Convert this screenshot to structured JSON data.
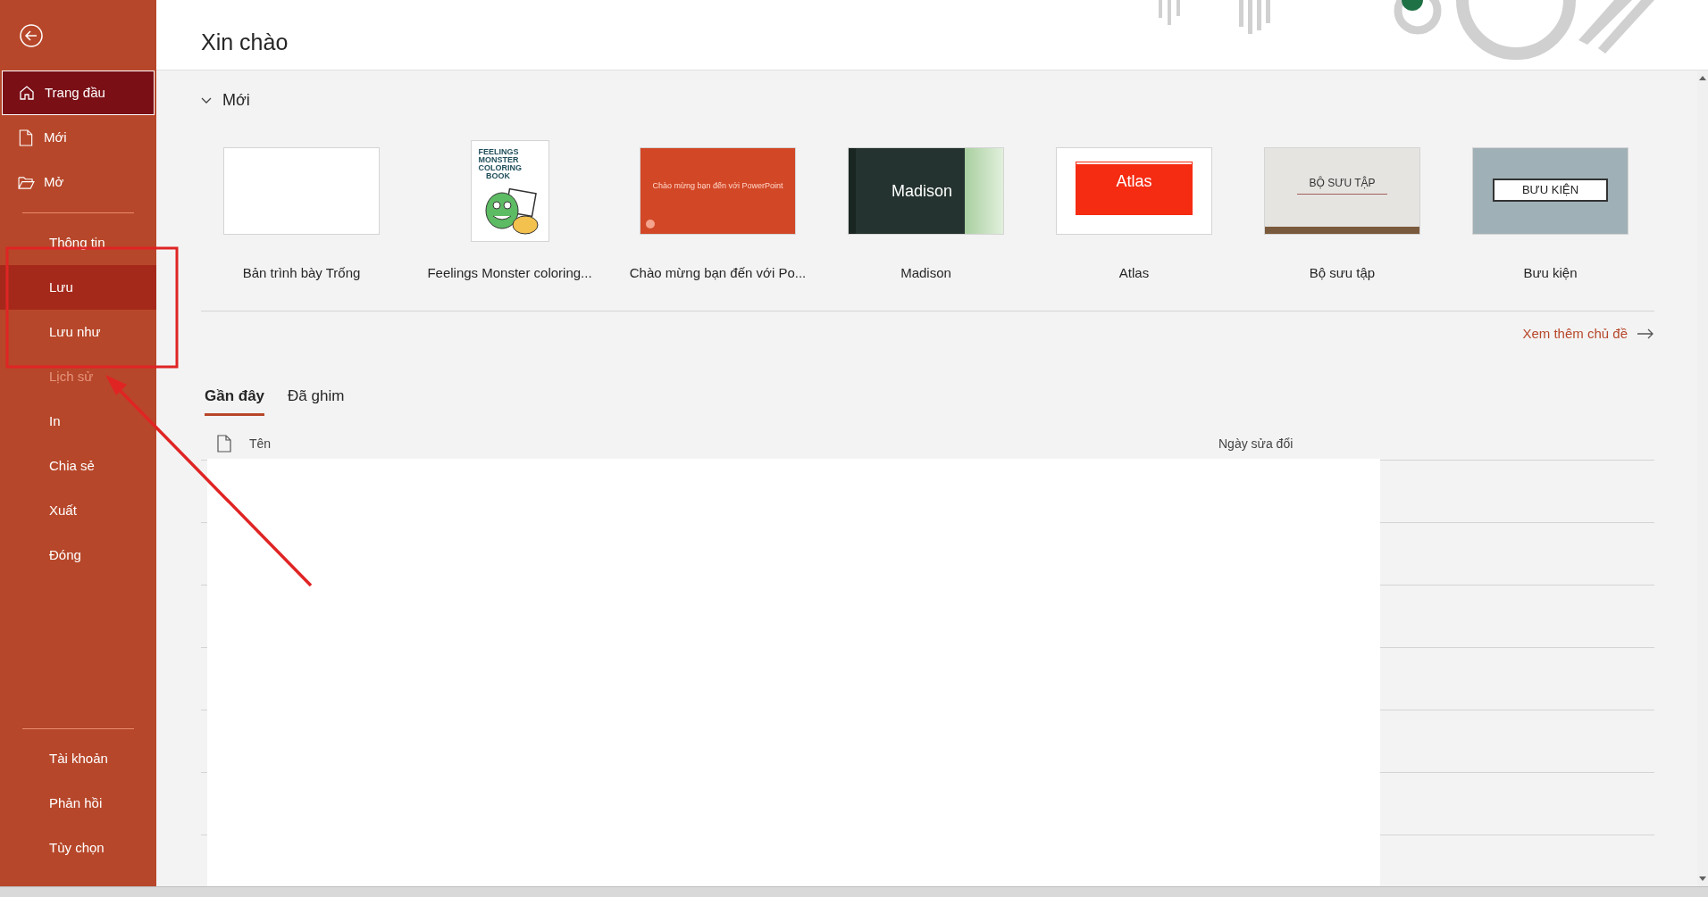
{
  "nav_top": [
    {
      "label": "Trang đầu",
      "kind": "home",
      "selected": true,
      "hovered": false,
      "disabled": false
    },
    {
      "label": "Mới",
      "kind": "file",
      "selected": false,
      "hovered": false,
      "disabled": false
    },
    {
      "label": "Mở",
      "kind": "folder",
      "selected": false,
      "hovered": false,
      "disabled": false
    }
  ],
  "nav_main": [
    {
      "label": "Thông tin",
      "selected": false,
      "hovered": false,
      "disabled": false
    },
    {
      "label": "Lưu",
      "selected": false,
      "hovered": true,
      "disabled": false
    },
    {
      "label": "Lưu như",
      "selected": false,
      "hovered": false,
      "disabled": false
    },
    {
      "label": "Lịch sử",
      "selected": false,
      "hovered": false,
      "disabled": true
    },
    {
      "label": "In",
      "selected": false,
      "hovered": false,
      "disabled": false
    },
    {
      "label": "Chia sẻ",
      "selected": false,
      "hovered": false,
      "disabled": false
    },
    {
      "label": "Xuất",
      "selected": false,
      "hovered": false,
      "disabled": false
    },
    {
      "label": "Đóng",
      "selected": false,
      "hovered": false,
      "disabled": false
    }
  ],
  "nav_bottom": [
    {
      "label": "Tài khoản",
      "selected": false,
      "hovered": false,
      "disabled": false
    },
    {
      "label": "Phản hồi",
      "selected": false,
      "hovered": false,
      "disabled": false
    },
    {
      "label": "Tùy chọn",
      "selected": false,
      "hovered": false,
      "disabled": false
    }
  ],
  "greeting": "Xin chào",
  "new_section": {
    "title": "Mới",
    "expanded": true,
    "templates": [
      {
        "name": "Bản trình bày Trống",
        "kind": "blank"
      },
      {
        "name": "Feelings Monster coloring...",
        "kind": "book",
        "thumbnail_text": "FEELINGS MONSTER COLORING BOOK"
      },
      {
        "name": "Chào mừng bạn đến với Po...",
        "kind": "welcome",
        "thumbnail_text": "Chào mừng bạn đến với PowerPoint"
      },
      {
        "name": "Madison",
        "kind": "madison",
        "thumbnail_text": "Madison"
      },
      {
        "name": "Atlas",
        "kind": "atlas",
        "thumbnail_text": "Atlas"
      },
      {
        "name": "Bộ sưu tập",
        "kind": "gallery",
        "thumbnail_text": "BỘ SƯU TẬP"
      },
      {
        "name": "Bưu kiện",
        "kind": "parcel",
        "thumbnail_text": "BƯU KIỆN"
      }
    ],
    "more_link": "Xem thêm chủ đề"
  },
  "recent": {
    "tabs": [
      {
        "label": "Gần đây",
        "selected": true
      },
      {
        "label": "Đã ghim",
        "selected": false
      }
    ],
    "columns": [
      "Tên",
      "Ngày sửa đổi"
    ]
  }
}
